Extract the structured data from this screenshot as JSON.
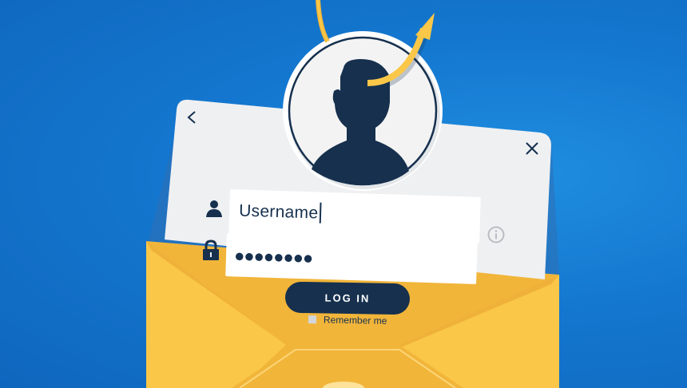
{
  "login_form": {
    "username_value": "Username",
    "password_mask": "●●●●●●●●",
    "login_label": "LOG IN",
    "remember_label": "Remember me"
  },
  "icons": {
    "back": "chevron-left",
    "close": "x-mark",
    "user": "person-silhouette",
    "lock": "padlock",
    "info": "info-circle",
    "hook": "fishing-hook"
  },
  "colors": {
    "background": "#1477cf",
    "card": "#eff0f2",
    "navy": "#16304e",
    "envelope": "#fac748",
    "envelope_dark": "#f1b53a"
  }
}
